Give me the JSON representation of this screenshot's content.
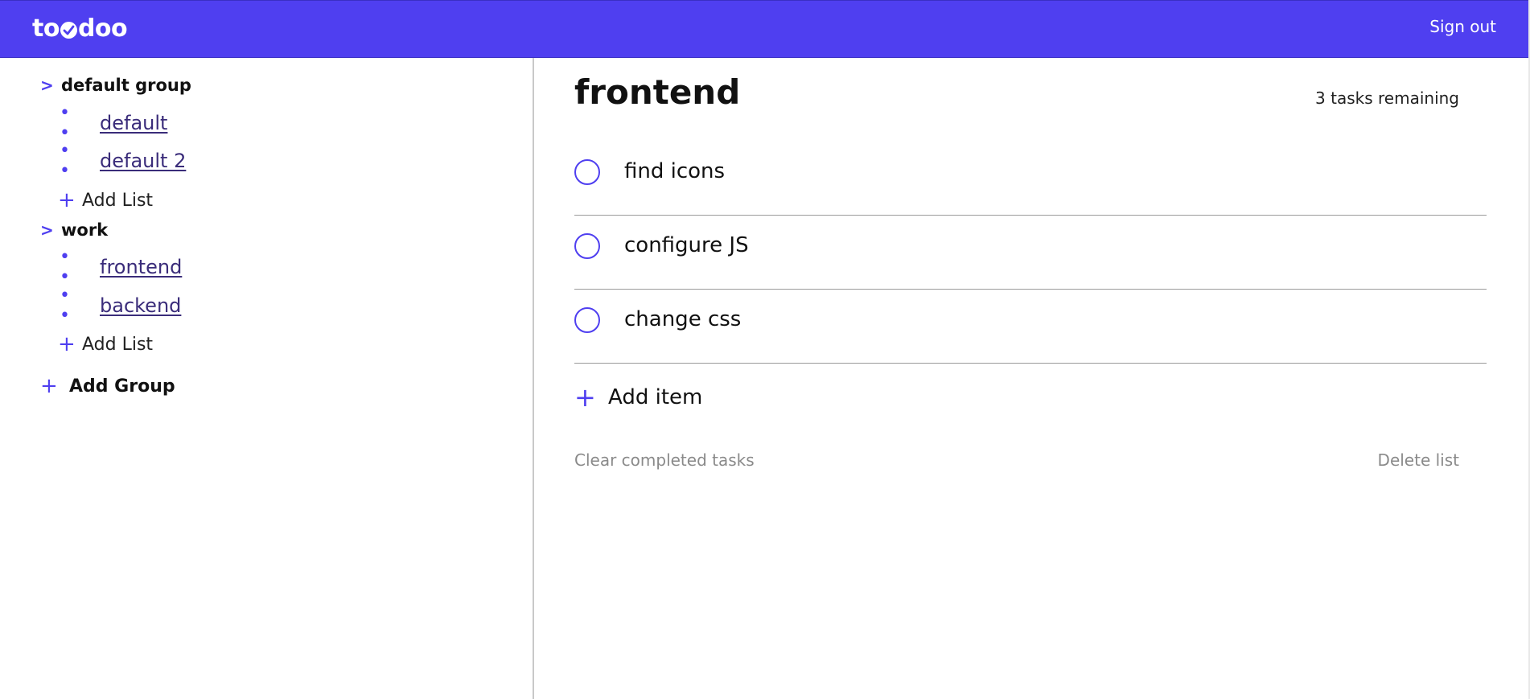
{
  "header": {
    "logo_text_left": "to",
    "logo_text_right": "doo",
    "signout_label": "Sign out",
    "brand_color": "#4f3ff0"
  },
  "sidebar": {
    "groups": [
      {
        "name": "default group",
        "chevron": ">",
        "lists": [
          {
            "bullet": "• •",
            "label": " default"
          },
          {
            "bullet": "• •",
            "label": " default 2"
          }
        ],
        "add_list_label": "Add List"
      },
      {
        "name": "work",
        "chevron": ">",
        "lists": [
          {
            "bullet": "• •",
            "label": " frontend"
          },
          {
            "bullet": "• •",
            "label": " backend"
          }
        ],
        "add_list_label": "Add List"
      }
    ],
    "add_group_label": "Add Group",
    "plus_icon": "+"
  },
  "main": {
    "title": "frontend",
    "tasks_remaining": "3 tasks remaining",
    "tasks": [
      {
        "text": "find icons",
        "completed": false
      },
      {
        "text": "configure JS",
        "completed": false
      },
      {
        "text": "change css",
        "completed": false
      }
    ],
    "add_item_label": "Add item",
    "clear_completed_label": "Clear completed tasks",
    "delete_list_label": "Delete list"
  }
}
